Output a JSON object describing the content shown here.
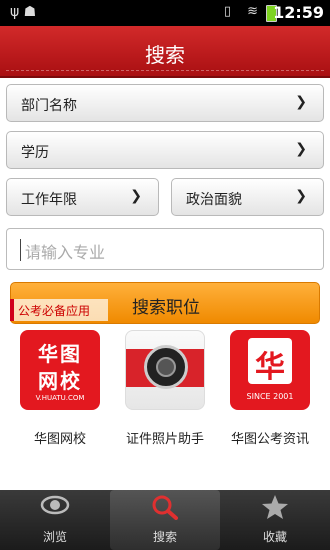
{
  "status_bar": {
    "time": "12:59",
    "left_icons": "ψ ☗",
    "right_icons": "▯ ≋"
  },
  "header": {
    "title": "搜索"
  },
  "filters": {
    "department": "部门名称",
    "education": "学历",
    "work_years": "工作年限",
    "political_status": "政治面貌",
    "chevron": "❯"
  },
  "search": {
    "placeholder": "请输入专业",
    "button_label": "搜索职位"
  },
  "ad_ribbon": "公考必备应用",
  "apps": [
    {
      "name": "华图网校",
      "line1": "华图",
      "line2": "网校",
      "line3": "V.HUATU.COM"
    },
    {
      "name": "证件照片助手"
    },
    {
      "name": "华图公考资讯",
      "glyph": "华",
      "since": "SINCE 2001"
    }
  ],
  "tabs": [
    {
      "label": "浏览",
      "icon": "eye-icon"
    },
    {
      "label": "搜索",
      "icon": "search-icon"
    },
    {
      "label": "收藏",
      "icon": "star-icon"
    }
  ],
  "colors": {
    "header_red": "#c41b1e",
    "button_orange": "#f5a021",
    "tab_bar": "#2a2a2a"
  }
}
